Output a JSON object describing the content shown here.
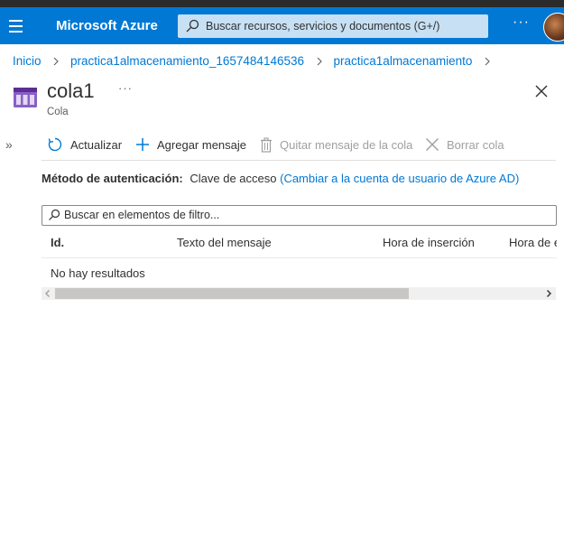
{
  "topbar": {
    "brand": "Microsoft Azure",
    "search_placeholder": "Buscar recursos, servicios y documentos (G+/)",
    "more": "···"
  },
  "breadcrumb": {
    "items": [
      "Inicio",
      "practica1almacenamiento_1657484146536",
      "practica1almacenamiento"
    ]
  },
  "resource": {
    "title": "cola1",
    "subtitle": "Cola",
    "more": "···"
  },
  "toolbar": {
    "refresh": "Actualizar",
    "add_message": "Agregar mensaje",
    "remove_message": "Quitar mensaje de la cola",
    "clear_queue": "Borrar cola"
  },
  "auth": {
    "label": "Método de autenticación:",
    "value": "Clave de acceso",
    "link": "(Cambiar a la cuenta de usuario de Azure AD)"
  },
  "filter": {
    "placeholder": "Buscar en elementos de filtro..."
  },
  "table": {
    "columns": [
      "Id.",
      "Texto del mensaje",
      "Hora de inserción",
      "Hora de expiración"
    ],
    "empty_text": "No hay resultados"
  },
  "colors": {
    "azure_blue": "#0078d4",
    "search_bg": "#c7e0f4",
    "queue_icon": "#8661c5"
  }
}
